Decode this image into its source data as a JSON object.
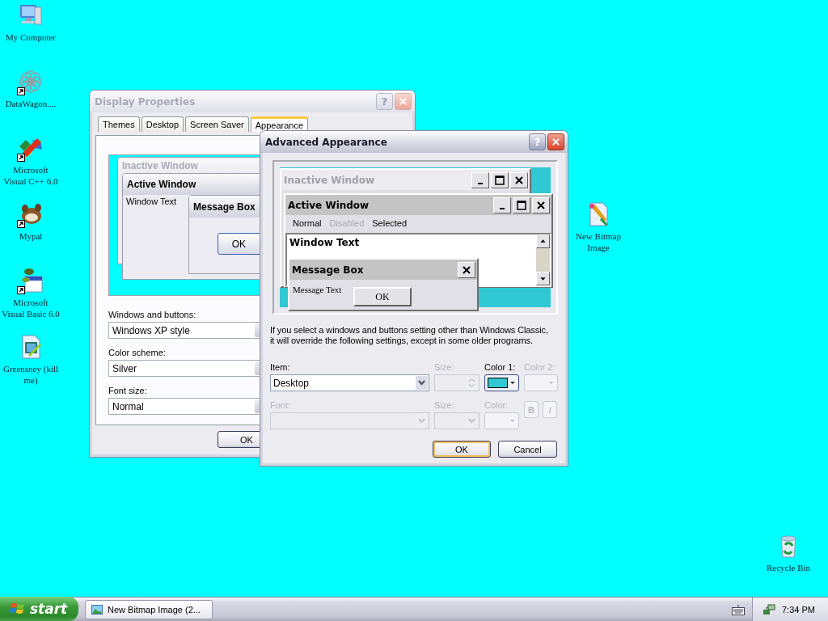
{
  "desktop": {
    "icons": [
      {
        "label": "My Computer",
        "shortcut": false
      },
      {
        "label": "DataWagon....",
        "shortcut": true
      },
      {
        "label": "Microsoft\nVisual C++ 6.0",
        "shortcut": true
      },
      {
        "label": "Mypal",
        "shortcut": true
      },
      {
        "label": "Microsoft\nVisual Basic 6.0",
        "shortcut": true
      },
      {
        "label": "Greensney (kill\nme)",
        "shortcut": false
      },
      {
        "label": "New Bitmap\nImage",
        "shortcut": false
      },
      {
        "label": "Recycle Bin",
        "shortcut": false
      }
    ]
  },
  "display_properties": {
    "title": "Display Properties",
    "active": false,
    "help_button": "?",
    "tabs": [
      {
        "label": "Themes",
        "selected": false
      },
      {
        "label": "Desktop",
        "selected": false
      },
      {
        "label": "Screen Saver",
        "selected": false
      },
      {
        "label": "Appearance",
        "selected": true
      }
    ],
    "preview": {
      "inactive_title": "Inactive Window",
      "active_title": "Active Window",
      "window_text": "Window Text",
      "message_title": "Message Box",
      "ok": "OK"
    },
    "fields": [
      {
        "label": "Windows and buttons:",
        "value": "Windows XP style"
      },
      {
        "label": "Color scheme:",
        "value": "Silver"
      },
      {
        "label": "Font size:",
        "value": "Normal"
      }
    ],
    "buttons": [
      "OK"
    ]
  },
  "advanced_appearance": {
    "title": "Advanced Appearance",
    "active": true,
    "help_button": "?",
    "preview": {
      "inactive_title": "Inactive Window",
      "active_title": "Active Window",
      "menu": [
        {
          "label": "Normal",
          "disabled": false
        },
        {
          "label": "Disabled",
          "disabled": true
        },
        {
          "label": "Selected",
          "disabled": false
        }
      ],
      "window_text": "Window Text",
      "message_title": "Message Box",
      "message_text": "Message Text",
      "ok": "OK"
    },
    "note": "If you select a windows and buttons setting other than Windows Classic,\nit will override the following settings, except in some older programs.",
    "item": {
      "label": "Item:",
      "value": "Desktop",
      "disabled": false
    },
    "size": {
      "label": "Size:",
      "disabled": true
    },
    "color1": {
      "label": "Color 1:",
      "color": "#30c8d2",
      "disabled": false
    },
    "color2": {
      "label": "Color 2:",
      "disabled": true
    },
    "font": {
      "label": "Font:",
      "disabled": true
    },
    "font_size": {
      "label": "Size:",
      "disabled": true
    },
    "font_color": {
      "label": "Color:",
      "disabled": true
    },
    "bold_button": {
      "label": "B",
      "disabled": true
    },
    "italic_button": {
      "label": "I",
      "disabled": true
    },
    "buttons": [
      {
        "label": "OK",
        "default": true
      },
      {
        "label": "Cancel",
        "default": false
      }
    ]
  },
  "taskbar": {
    "start": "start",
    "tasks": [
      {
        "label": "New Bitmap Image (2...",
        "selected": false
      }
    ],
    "clock": "7:34 PM"
  }
}
